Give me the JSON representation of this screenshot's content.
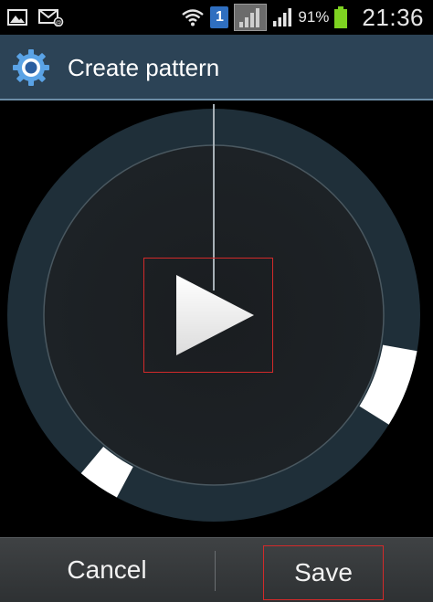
{
  "status_bar": {
    "icons": [
      "gallery-icon",
      "email-notification-icon",
      "wifi-icon",
      "sim-icon",
      "signal-blocked-icon",
      "signal-icon",
      "battery-icon"
    ],
    "sim_label": "1",
    "battery_percent": "91%",
    "time": "21:36",
    "battery_color": "#7ed321"
  },
  "title_bar": {
    "icon": "gear-icon",
    "title": "Create pattern",
    "background": "#2c4356"
  },
  "dial": {
    "markers": [
      {
        "name": "marker-right",
        "start_deg": 100,
        "end_deg": 122
      },
      {
        "name": "marker-bottom-left",
        "start_deg": 208,
        "end_deg": 220
      }
    ]
  },
  "buttons": {
    "cancel_label": "Cancel",
    "save_label": "Save"
  }
}
